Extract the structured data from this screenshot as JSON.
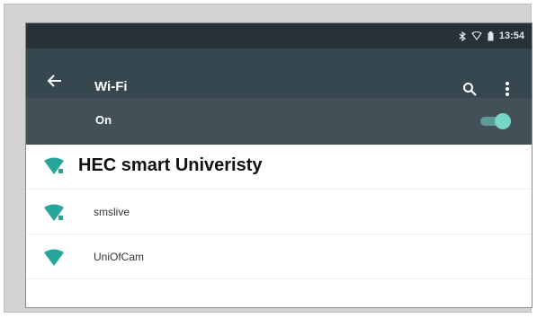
{
  "status_bar": {
    "time": "13:54",
    "icons": [
      "bluetooth-icon",
      "wifi-status-icon",
      "battery-icon"
    ]
  },
  "app_bar": {
    "title": "Wi-Fi",
    "icons": [
      "back-arrow-icon",
      "search-icon",
      "more-vert-icon"
    ]
  },
  "wifi_switch": {
    "label": "On",
    "enabled": true
  },
  "networks": [
    {
      "ssid": "HEC smart Univeristy",
      "icon": "wifi-signal-icon"
    },
    {
      "ssid": "smslive",
      "icon": "wifi-signal-icon"
    },
    {
      "ssid": "UniOfCam",
      "icon": "wifi-signal-icon"
    }
  ],
  "colors": {
    "status_bar": "#263238",
    "app_bar": "#37474f",
    "switch_bar": "#415157",
    "accent": "#26a69a",
    "toggle_thumb": "#76d6c8"
  }
}
